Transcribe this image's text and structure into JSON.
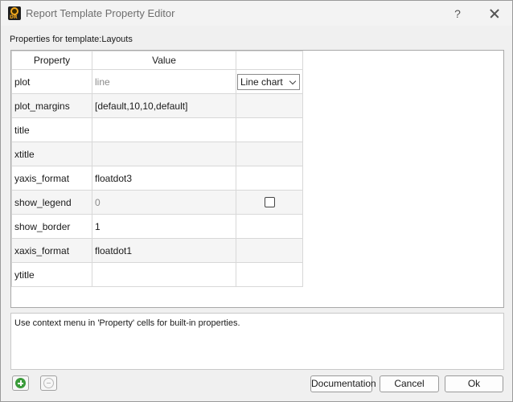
{
  "window": {
    "title": "Report Template Property Editor",
    "help_glyph": "?",
    "app_icon_text": "DR"
  },
  "header": {
    "label": "Properties for template:Layouts"
  },
  "table": {
    "columns": [
      "Property",
      "Value",
      ""
    ],
    "rows": [
      {
        "property": "plot",
        "value": "line",
        "value_dimmed": true,
        "extra": "combo",
        "extra_value": "Line chart"
      },
      {
        "property": "plot_margins",
        "value": "[default,10,10,default]",
        "value_dimmed": false,
        "extra": ""
      },
      {
        "property": "title",
        "value": "",
        "value_dimmed": false,
        "extra": ""
      },
      {
        "property": "xtitle",
        "value": "",
        "value_dimmed": false,
        "extra": ""
      },
      {
        "property": "yaxis_format",
        "value": "floatdot3",
        "value_dimmed": false,
        "extra": ""
      },
      {
        "property": "show_legend",
        "value": "0",
        "value_dimmed": true,
        "extra": "checkbox",
        "extra_checked": false
      },
      {
        "property": "show_border",
        "value": "1",
        "value_dimmed": false,
        "extra": ""
      },
      {
        "property": "xaxis_format",
        "value": "floatdot1",
        "value_dimmed": false,
        "extra": ""
      },
      {
        "property": "ytitle",
        "value": "",
        "value_dimmed": false,
        "extra": ""
      }
    ]
  },
  "hint": {
    "text": "Use context menu in 'Property' cells for built-in properties."
  },
  "buttons": {
    "documentation": "Documentation",
    "cancel": "Cancel",
    "ok": "Ok"
  },
  "colors": {
    "add_icon": "#3a9b3a",
    "app_icon_accent": "#f2a81d"
  }
}
